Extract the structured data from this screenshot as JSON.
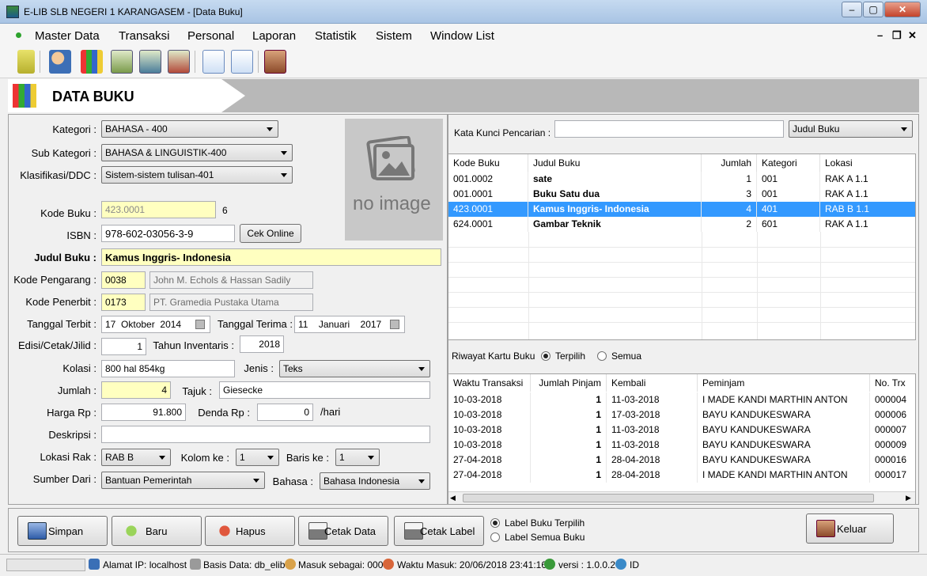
{
  "window": {
    "title": "E-LIB SLB NEGERI 1 KARANGASEM - [Data Buku]",
    "min": "‒",
    "max": "▢",
    "close": "✕"
  },
  "menu": [
    "Master Data",
    "Transaksi",
    "Personal",
    "Laporan",
    "Statistik",
    "Sistem",
    "Window List"
  ],
  "mdi": {
    "min": "–",
    "restore": "❐",
    "close": "✕"
  },
  "toolbar": [
    "key-icon",
    "add-user-icon",
    "books-icon",
    "borrow-icon",
    "return-icon",
    "delete-loan-icon",
    "export-icon",
    "import-icon",
    "exit-icon"
  ],
  "header": {
    "title": "DATA BUKU"
  },
  "form": {
    "kategori_label": "Kategori :",
    "kategori": "BAHASA - 400",
    "subkategori_label": "Sub Kategori :",
    "subkategori": "BAHASA & LINGUISTIK-400",
    "klasifikasi_label": "Klasifikasi/DDC :",
    "klasifikasi": "Sistem-sistem tulisan-401",
    "kode_buku_label": "Kode Buku :",
    "kode_buku": "423.0001",
    "kode_buku_count": "6",
    "isbn_label": "ISBN :",
    "isbn": "978-602-03056-3-9",
    "cek_online": "Cek Online",
    "judul_label": "Judul Buku :",
    "judul": "Kamus Inggris- Indonesia",
    "pengarang_label": "Kode Pengarang :",
    "pengarang_kode": "0038",
    "pengarang_nama": "John M. Echols & Hassan Sadily",
    "penerbit_label": "Kode Penerbit :",
    "penerbit_kode": "0173",
    "penerbit_nama": "PT. Gramedia Pustaka Utama",
    "terbit_label": "Tanggal Terbit :",
    "terbit_d": "17",
    "terbit_m": "Oktober",
    "terbit_y": "2014",
    "terima_label": "Tanggal Terima :",
    "terima_d": "11",
    "terima_m": "Januari",
    "terima_y": "2017",
    "edisi_label": "Edisi/Cetak/Jilid :",
    "edisi": "1",
    "inventaris_label": "Tahun Inventaris :",
    "inventaris": "2018",
    "kolasi_label": "Kolasi :",
    "kolasi": "800 hal 854kg",
    "jenis_label": "Jenis :",
    "jenis": "Teks",
    "jumlah_label": "Jumlah :",
    "jumlah": "4",
    "tajuk_label": "Tajuk :",
    "tajuk": "Giesecke",
    "harga_label": "Harga Rp :",
    "harga": "91.800",
    "denda_label": "Denda Rp :",
    "denda": "0",
    "denda_unit": "/hari",
    "deskripsi_label": "Deskripsi :",
    "deskripsi": "",
    "lokasi_label": "Lokasi Rak :",
    "lokasi": "RAB B",
    "kolom_label": "Kolom ke :",
    "kolom": "1",
    "baris_label": "Baris ke :",
    "baris": "1",
    "sumber_label": "Sumber Dari :",
    "sumber": "Bantuan Pemerintah",
    "bahasa_label": "Bahasa :",
    "bahasa": "Bahasa Indonesia",
    "no_image": "no image"
  },
  "search": {
    "label": "Kata Kunci Pencarian :",
    "value": "",
    "field": "Judul Buku"
  },
  "books": {
    "headers": [
      "Kode Buku",
      "Judul Buku",
      "Jumlah",
      "Kategori",
      "Lokasi"
    ],
    "rows": [
      [
        "001.0002",
        "sate",
        "1",
        "001",
        "RAK A 1.1"
      ],
      [
        "001.0001",
        "Buku Satu dua",
        "3",
        "001",
        "RAK A 1.1"
      ],
      [
        "423.0001",
        "Kamus Inggris- Indonesia",
        "4",
        "401",
        "RAB B 1.1"
      ],
      [
        "624.0001",
        "Gambar Teknik",
        "2",
        "601",
        "RAK A 1.1"
      ]
    ]
  },
  "riwayat": {
    "label": "Riwayat Kartu Buku",
    "opt1": "Terpilih",
    "opt2": "Semua"
  },
  "loans": {
    "headers": [
      "Waktu Transaksi",
      "Jumlah Pinjam",
      "Kembali",
      "Peminjam",
      "No. Trx"
    ],
    "rows": [
      [
        "10-03-2018",
        "1",
        "11-03-2018",
        "I MADE KANDI MARTHIN ANTON",
        "000004"
      ],
      [
        "10-03-2018",
        "1",
        "17-03-2018",
        "BAYU KANDUKESWARA",
        "000006"
      ],
      [
        "10-03-2018",
        "1",
        "11-03-2018",
        "BAYU KANDUKESWARA",
        "000007"
      ],
      [
        "10-03-2018",
        "1",
        "11-03-2018",
        "BAYU KANDUKESWARA",
        "000009"
      ],
      [
        "27-04-2018",
        "1",
        "28-04-2018",
        "BAYU KANDUKESWARA",
        "000016"
      ],
      [
        "27-04-2018",
        "1",
        "28-04-2018",
        "I MADE KANDI MARTHIN ANTON",
        "000017"
      ]
    ]
  },
  "actions": {
    "simpan": "Simpan",
    "baru": "Baru",
    "hapus": "Hapus",
    "cetak_data": "Cetak Data",
    "cetak_label": "Cetak Label",
    "label_opt1": "Label Buku Terpilih",
    "label_opt2": "Label Semua Buku",
    "keluar": "Keluar"
  },
  "status": {
    "ip": "Alamat IP: localhost",
    "db": "Basis Data: db_elib",
    "user": "Masuk sebagai: 000",
    "time": "Waktu Masuk: 20/06/2018 23:41:16",
    "version": "versi : 1.0.0.2",
    "lang": "ID"
  }
}
